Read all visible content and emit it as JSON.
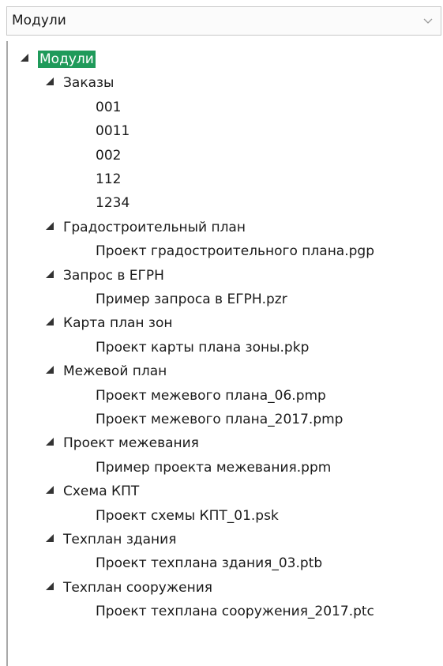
{
  "combo": {
    "value": "Модули"
  },
  "tree": {
    "root": "Модули",
    "groups": [
      {
        "label": "Заказы",
        "items": [
          "001",
          "0011",
          "002",
          "112",
          "1234"
        ]
      },
      {
        "label": "Градостроительный план",
        "items": [
          "Проект градостроительного плана.pgp"
        ]
      },
      {
        "label": "Запрос в ЕГРН",
        "items": [
          "Пример запроса в ЕГРН.pzr"
        ]
      },
      {
        "label": "Карта план зон",
        "items": [
          "Проект карты плана зоны.pkp"
        ]
      },
      {
        "label": "Межевой план",
        "items": [
          "Проект межевого плана_06.pmp",
          "Проект межевого плана_2017.pmp"
        ]
      },
      {
        "label": "Проект межевания",
        "items": [
          "Пример проекта межевания.ppm"
        ]
      },
      {
        "label": "Схема КПТ",
        "items": [
          "Проект схемы КПТ_01.psk"
        ]
      },
      {
        "label": "Техплан здания",
        "items": [
          "Проект техплана здания_03.ptb"
        ]
      },
      {
        "label": "Техплан сооружения",
        "items": [
          "Проект техплана сооружения_2017.ptc"
        ]
      }
    ]
  }
}
